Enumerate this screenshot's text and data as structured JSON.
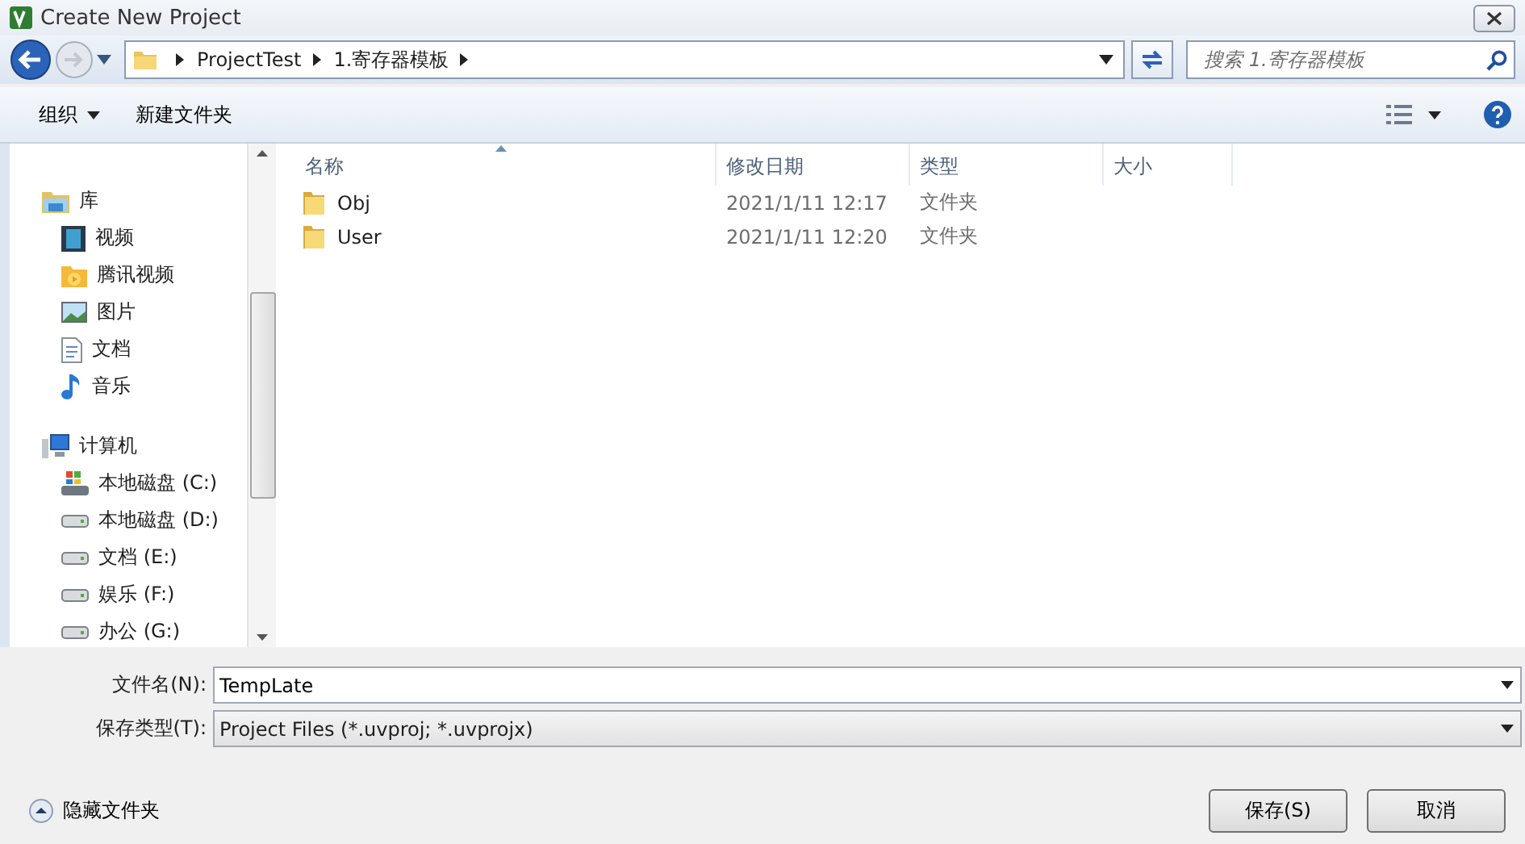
{
  "window": {
    "title": "Create New Project"
  },
  "address_bar": {
    "crumbs": [
      "ProjectTest",
      "1.寄存器模板"
    ]
  },
  "search": {
    "placeholder": "搜索 1.寄存器模板"
  },
  "toolbar": {
    "organize": "组织",
    "new_folder": "新建文件夹"
  },
  "sidebar": {
    "groups": [
      {
        "label": "库",
        "kind": "library",
        "children": [
          {
            "label": "视频",
            "kind": "video"
          },
          {
            "label": "腾讯视频",
            "kind": "tencent"
          },
          {
            "label": "图片",
            "kind": "picture"
          },
          {
            "label": "文档",
            "kind": "doc"
          },
          {
            "label": "音乐",
            "kind": "music"
          }
        ]
      },
      {
        "label": "计算机",
        "kind": "computer",
        "children": [
          {
            "label": "本地磁盘 (C:)",
            "kind": "system-drive"
          },
          {
            "label": "本地磁盘 (D:)",
            "kind": "drive"
          },
          {
            "label": "文档 (E:)",
            "kind": "drive"
          },
          {
            "label": "娱乐 (F:)",
            "kind": "drive"
          },
          {
            "label": "办公 (G:)",
            "kind": "drive"
          }
        ]
      }
    ]
  },
  "table": {
    "columns": [
      {
        "label": "名称",
        "sorted": true
      },
      {
        "label": "修改日期",
        "sorted": false
      },
      {
        "label": "类型",
        "sorted": false
      },
      {
        "label": "大小",
        "sorted": false
      }
    ],
    "rows": [
      {
        "name": "Obj",
        "date": "2021/1/11 12:17",
        "type": "文件夹",
        "selected": false
      },
      {
        "name": "User",
        "date": "2021/1/11 12:20",
        "type": "文件夹",
        "selected": false
      }
    ]
  },
  "form": {
    "file_name_label": "文件名(N):",
    "file_name": "TempLate",
    "type_label": "保存类型(T):",
    "type_value": "Project Files (*.uvproj; *.uvprojx)"
  },
  "hide_folders": "隐藏文件夹",
  "buttons": [
    "保存(S)",
    "取消"
  ]
}
